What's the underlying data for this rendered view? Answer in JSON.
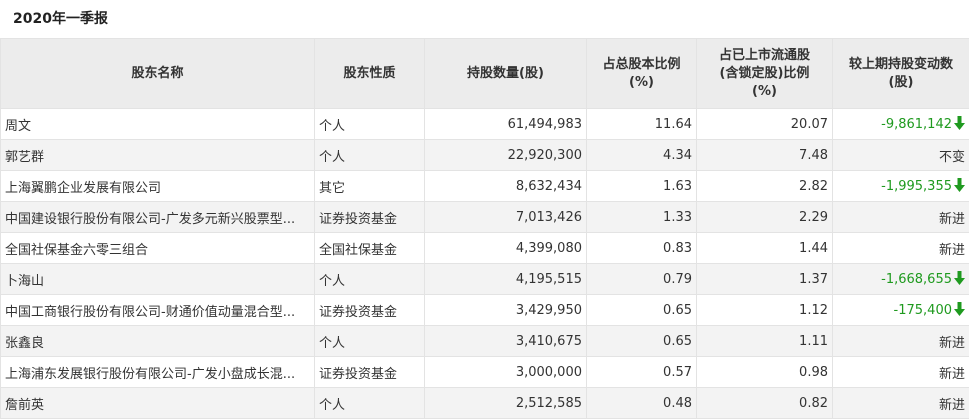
{
  "report_title": "2020年一季报",
  "headers": {
    "name": "股东名称",
    "nature": "股东性质",
    "shares": "持股数量(股)",
    "pct_total_line1": "占总股本比例",
    "pct_total_line2": "(%)",
    "pct_float_line1": "占已上市流通股",
    "pct_float_line2": "(含锁定股)比例",
    "pct_float_line3": "(%)",
    "change_line1": "较上期持股变动数",
    "change_line2": "(股)"
  },
  "colors": {
    "decrease": "#1f9a1f",
    "header_bg": "#ececec",
    "stripe_bg": "#f3f3f3"
  },
  "rows": [
    {
      "name": "周文",
      "nature": "个人",
      "shares": "61,494,983",
      "pct_total": "11.64",
      "pct_float": "20.07",
      "change": "-9,861,142",
      "arrow": "down-arrow-icon"
    },
    {
      "name": "郭艺群",
      "nature": "个人",
      "shares": "22,920,300",
      "pct_total": "4.34",
      "pct_float": "7.48",
      "change": "不变",
      "arrow": ""
    },
    {
      "name": "上海翼鹏企业发展有限公司",
      "nature": "其它",
      "shares": "8,632,434",
      "pct_total": "1.63",
      "pct_float": "2.82",
      "change": "-1,995,355",
      "arrow": "down-arrow-icon"
    },
    {
      "name": "中国建设银行股份有限公司-广发多元新兴股票型...",
      "nature": "证券投资基金",
      "shares": "7,013,426",
      "pct_total": "1.33",
      "pct_float": "2.29",
      "change": "新进",
      "arrow": ""
    },
    {
      "name": "全国社保基金六零三组合",
      "nature": "全国社保基金",
      "shares": "4,399,080",
      "pct_total": "0.83",
      "pct_float": "1.44",
      "change": "新进",
      "arrow": ""
    },
    {
      "name": "卜海山",
      "nature": "个人",
      "shares": "4,195,515",
      "pct_total": "0.79",
      "pct_float": "1.37",
      "change": "-1,668,655",
      "arrow": "down-arrow-icon"
    },
    {
      "name": "中国工商银行股份有限公司-财通价值动量混合型...",
      "nature": "证券投资基金",
      "shares": "3,429,950",
      "pct_total": "0.65",
      "pct_float": "1.12",
      "change": "-175,400",
      "arrow": "down-arrow-icon"
    },
    {
      "name": "张鑫良",
      "nature": "个人",
      "shares": "3,410,675",
      "pct_total": "0.65",
      "pct_float": "1.11",
      "change": "新进",
      "arrow": ""
    },
    {
      "name": "上海浦东发展银行股份有限公司-广发小盘成长混...",
      "nature": "证券投资基金",
      "shares": "3,000,000",
      "pct_total": "0.57",
      "pct_float": "0.98",
      "change": "新进",
      "arrow": ""
    },
    {
      "name": "詹前英",
      "nature": "个人",
      "shares": "2,512,585",
      "pct_total": "0.48",
      "pct_float": "0.82",
      "change": "新进",
      "arrow": ""
    }
  ]
}
